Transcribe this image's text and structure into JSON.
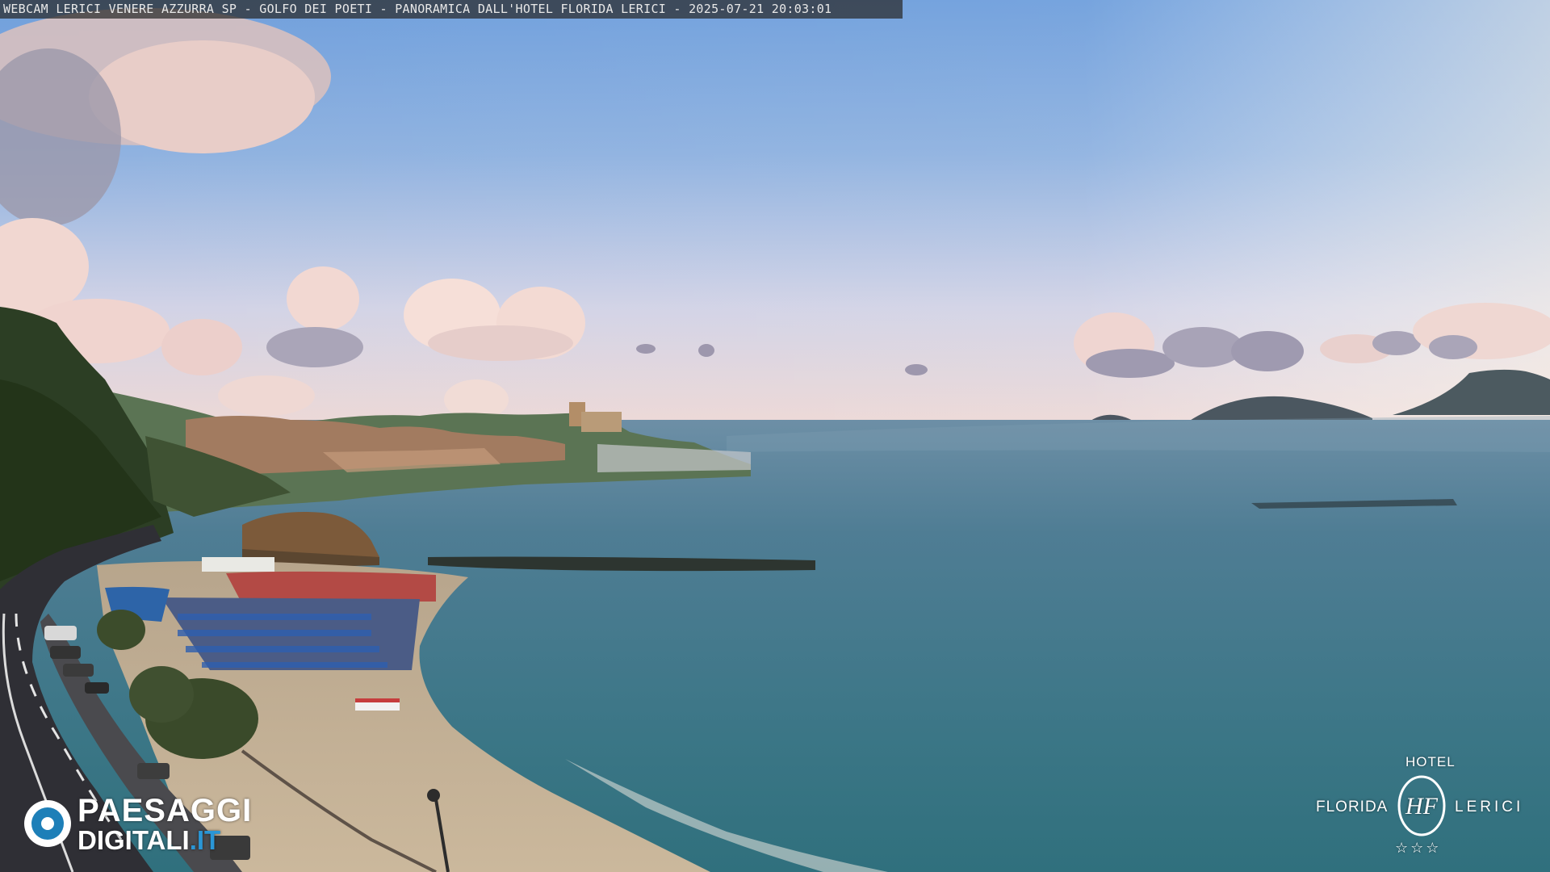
{
  "overlay": {
    "caption": "WEBCAM LERICI VENERE AZZURRA SP - GOLFO DEI POETI - PANORAMICA DALL'HOTEL FLORIDA LERICI - 2025-07-21 20:03:01"
  },
  "watermark_left": {
    "line1": "PAESAGGI",
    "line2_main": "DIGITALI",
    "line2_tld": ".IT",
    "tld_color": "#2a96d6"
  },
  "watermark_right": {
    "hotel": "HOTEL",
    "florida": "FLORIDA",
    "lerici": "LERICI",
    "monogram": "HF",
    "stars": "☆☆☆"
  }
}
